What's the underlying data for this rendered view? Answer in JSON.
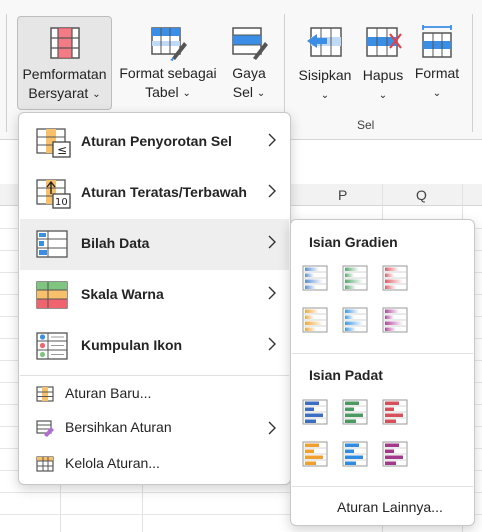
{
  "ribbon": {
    "conditional_formatting": {
      "line1": "Pemformatan",
      "line2": "Bersyarat",
      "chevron": "⌄",
      "icon": "conditional-formatting-icon"
    },
    "format_as_table": {
      "line1": "Format sebagai",
      "line2": "Tabel",
      "chevron": "⌄",
      "icon": "format-as-table-icon"
    },
    "cell_styles": {
      "line1": "Gaya",
      "line2": "Sel",
      "chevron": "⌄",
      "icon": "cell-styles-icon"
    },
    "insert": {
      "line1": "Sisipkan",
      "chevron": "⌄",
      "icon": "insert-cells-icon"
    },
    "delete": {
      "line1": "Hapus",
      "chevron": "⌄",
      "icon": "delete-cells-icon"
    },
    "format": {
      "line1": "Format",
      "chevron": "⌄",
      "icon": "format-cells-icon"
    },
    "cells_group_label": "Sel"
  },
  "sheet": {
    "columns": [
      "P",
      "Q"
    ]
  },
  "menu": {
    "items": [
      {
        "label": "Aturan Penyorotan Sel",
        "icon": "highlight-cells-rules-icon",
        "has_submenu": true
      },
      {
        "label": "Aturan Teratas/Terbawah",
        "icon": "top-bottom-rules-icon",
        "has_submenu": true
      },
      {
        "label": "Bilah Data",
        "icon": "data-bars-icon",
        "has_submenu": true,
        "active": true
      },
      {
        "label": "Skala Warna",
        "icon": "color-scales-icon",
        "has_submenu": true
      },
      {
        "label": "Kumpulan Ikon",
        "icon": "icon-sets-icon",
        "has_submenu": true
      }
    ],
    "small_items": [
      {
        "label": "Aturan Baru...",
        "icon": "new-rule-icon"
      },
      {
        "label": "Bersihkan Aturan",
        "icon": "clear-rules-icon",
        "has_submenu": true
      },
      {
        "label": "Kelola Aturan...",
        "icon": "manage-rules-icon"
      }
    ]
  },
  "submenu": {
    "gradient_title": "Isian Gradien",
    "solid_title": "Isian Padat",
    "more_rules": "Aturan Lainnya...",
    "gradient_colors": [
      "#5b8fd6",
      "#5aaa72",
      "#e0606a",
      "#f2a83c",
      "#3f9be6",
      "#b34a9e"
    ],
    "solid_colors": [
      "#3c6fc1",
      "#4a9a62",
      "#d5505b",
      "#f0a030",
      "#2f8ce0",
      "#a23a8c"
    ]
  },
  "colors": {
    "accent": "#217346",
    "menu_active": "#eeeeee"
  }
}
